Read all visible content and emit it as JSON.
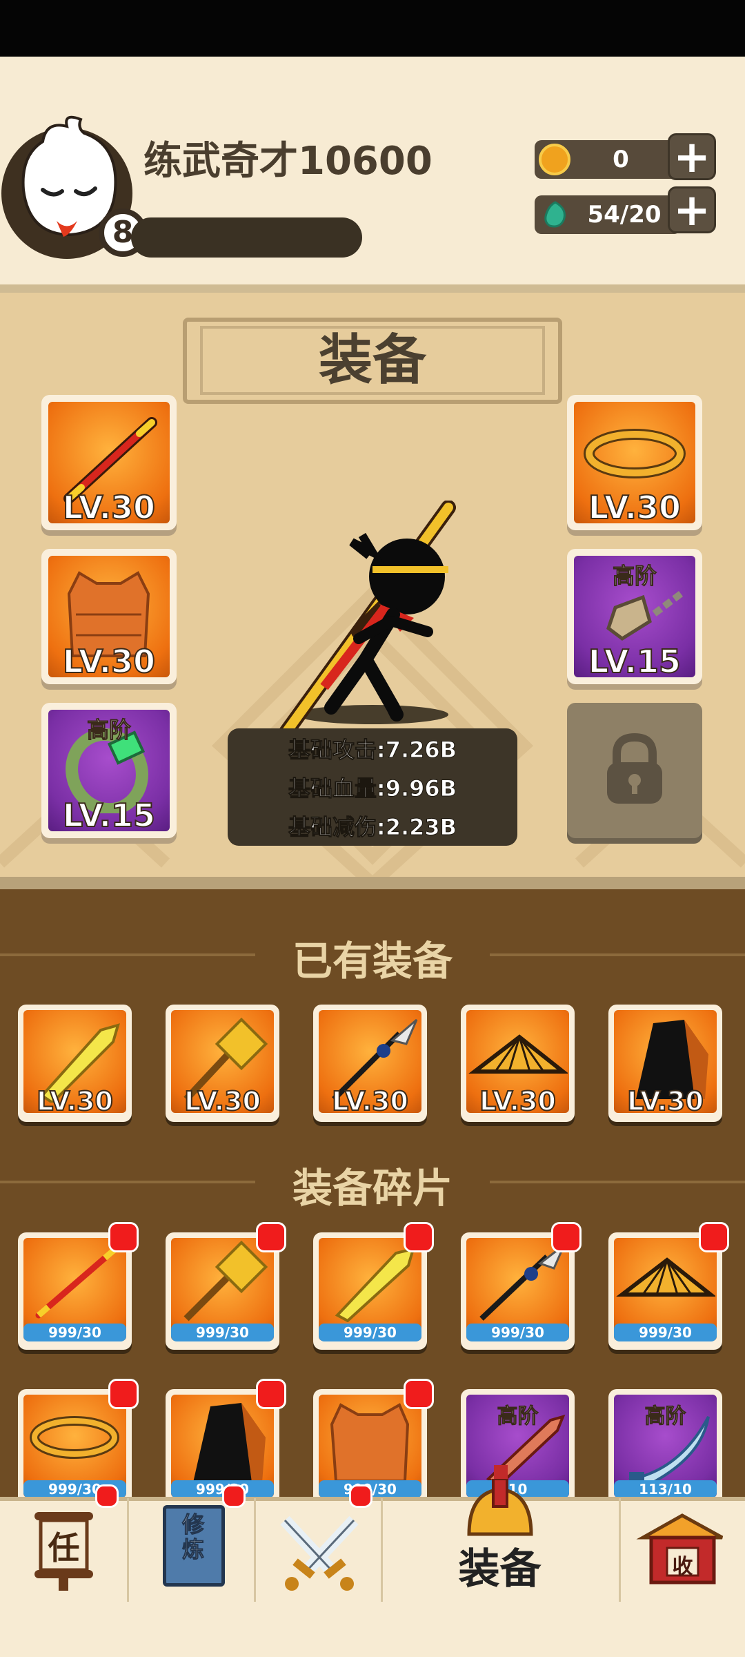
{
  "header": {
    "player_name": "练武奇才10600",
    "level": "8",
    "coin_value": "0",
    "gem_value": "54/20",
    "plus_label": "+"
  },
  "equip_panel": {
    "title": "装备",
    "slots_left": [
      {
        "item": "staff",
        "level": "LV.30",
        "tier": "",
        "color": "orange"
      },
      {
        "item": "vest",
        "level": "LV.30",
        "tier": "",
        "color": "orange"
      },
      {
        "item": "bracelet",
        "level": "LV.15",
        "tier": "高阶",
        "color": "purple"
      }
    ],
    "slots_right": [
      {
        "item": "headband",
        "level": "LV.30",
        "tier": "",
        "color": "orange"
      },
      {
        "item": "necklace",
        "level": "LV.15",
        "tier": "高阶",
        "color": "purple"
      }
    ],
    "stats": [
      "基础攻击:7.26B",
      "基础血量:9.96B",
      "基础减伤:2.23B"
    ]
  },
  "owned": {
    "title": "已有装备",
    "items": [
      {
        "item": "sword",
        "level": "LV.30"
      },
      {
        "item": "hammer",
        "level": "LV.30"
      },
      {
        "item": "spear",
        "level": "LV.30"
      },
      {
        "item": "hat",
        "level": "LV.30"
      },
      {
        "item": "cloak",
        "level": "LV.30"
      }
    ]
  },
  "fragments": {
    "title": "装备碎片",
    "items": [
      {
        "item": "staff",
        "progress": "999/30",
        "tier": "",
        "color": "orange"
      },
      {
        "item": "hammer",
        "progress": "999/30",
        "tier": "",
        "color": "orange"
      },
      {
        "item": "sword",
        "progress": "999/30",
        "tier": "",
        "color": "orange"
      },
      {
        "item": "spear",
        "progress": "999/30",
        "tier": "",
        "color": "orange"
      },
      {
        "item": "hat",
        "progress": "999/30",
        "tier": "",
        "color": "orange"
      },
      {
        "item": "headband",
        "progress": "999/30",
        "tier": "",
        "color": "orange"
      },
      {
        "item": "cloak",
        "progress": "999/30",
        "tier": "",
        "color": "orange"
      },
      {
        "item": "vest",
        "progress": "999/30",
        "tier": "",
        "color": "orange"
      },
      {
        "item": "red-sword",
        "progress": "10",
        "tier": "高阶",
        "color": "purple"
      },
      {
        "item": "blue-blade",
        "progress": "113/10",
        "tier": "高阶",
        "color": "purple"
      }
    ]
  },
  "nav": {
    "task_glyph": "任",
    "train_glyph": "修炼",
    "active_label": "装备",
    "collect_glyph": "收"
  }
}
